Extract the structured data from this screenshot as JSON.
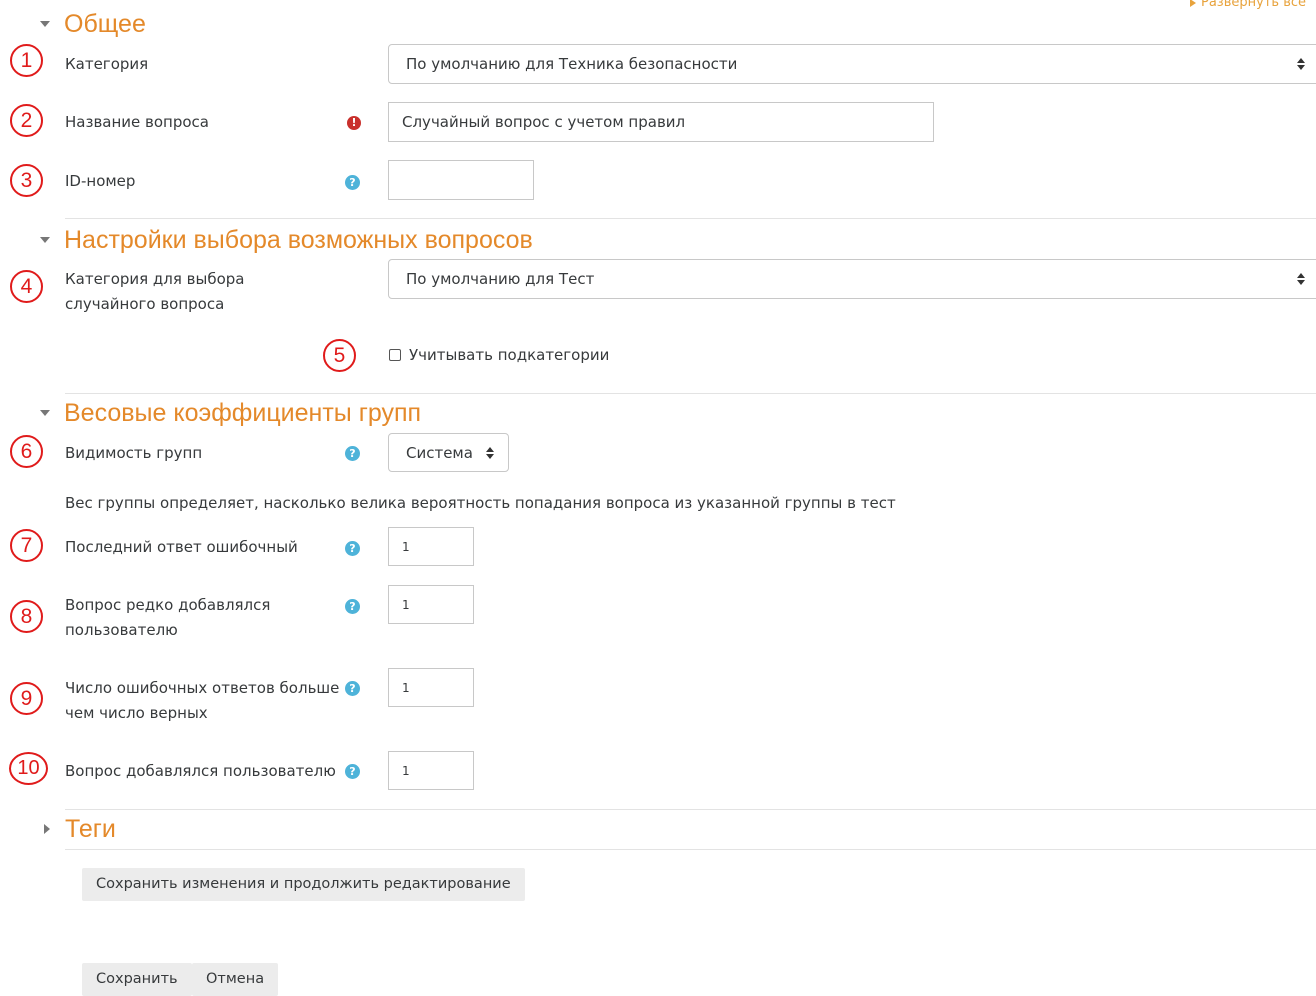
{
  "expand_all_label": "Развернуть все",
  "sections": {
    "general": {
      "title": "Общее"
    },
    "selection": {
      "title": "Настройки выбора возможных вопросов"
    },
    "weights": {
      "title": "Весовые коэффициенты групп"
    },
    "tags": {
      "title": "Теги"
    }
  },
  "markers": [
    "1",
    "2",
    "3",
    "4",
    "5",
    "6",
    "7",
    "8",
    "9",
    "10"
  ],
  "fields": {
    "category": {
      "label": "Категория",
      "value": "По умолчанию для Техника безопасности"
    },
    "question_name": {
      "label": "Название вопроса",
      "value": "Случайный вопрос с учетом правил"
    },
    "id_number": {
      "label": "ID-номер",
      "value": ""
    },
    "random_category": {
      "label": "Категория для выбора случайного вопроса",
      "value": "По умолчанию для Тест"
    },
    "include_subcategories": {
      "label": "Учитывать подкатегории",
      "checked": false
    },
    "group_visibility": {
      "label": "Видимость групп",
      "value": "Система"
    },
    "weight_description": "Вес группы определяет, насколько велика вероятность попадания вопроса из указанной группы в тест",
    "last_answer_wrong": {
      "label": "Последний ответ ошибочный",
      "value": "1"
    },
    "rarely_added": {
      "label": "Вопрос редко добавлялся пользователю",
      "value": "1"
    },
    "more_wrong_than_right": {
      "label": "Число ошибочных ответов больше чем число верных",
      "value": "1"
    },
    "was_added": {
      "label": "Вопрос добавлялся пользователю",
      "value": "1"
    }
  },
  "buttons": {
    "save_continue": "Сохранить изменения и продолжить редактирование",
    "save": "Сохранить",
    "cancel": "Отмена"
  },
  "icons": {
    "required": "exclamation-circle-icon",
    "help": "question-circle-icon"
  },
  "colors": {
    "section_title": "#e4892a",
    "marker": "#e01b1b",
    "help_icon": "#4eb3d9",
    "required_icon": "#c9302c"
  }
}
